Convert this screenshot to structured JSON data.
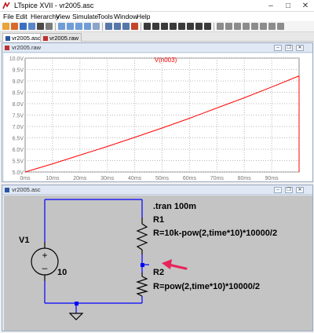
{
  "app": {
    "title": "LTspice XVII - vr2005.asc"
  },
  "menu": {
    "items": [
      "File",
      "Edit",
      "Hierarchy",
      "View",
      "Simulate",
      "Tools",
      "Window",
      "Help"
    ]
  },
  "tabs": [
    {
      "label": "vr2005.asc",
      "icon": "schematic-icon"
    },
    {
      "label": "vr2005.raw",
      "icon": "waveform-icon"
    }
  ],
  "waveform": {
    "window_title": "vr2005.raw",
    "trace_name": "V(n003)",
    "trace_color": "#ff0000",
    "y_ticks": [
      "10.0V",
      "9.5V",
      "9.0V",
      "8.5V",
      "8.0V",
      "7.5V",
      "7.0V",
      "6.5V",
      "6.0V",
      "5.5V",
      "5.0V"
    ],
    "x_ticks": [
      "0ms",
      "10ms",
      "20ms",
      "30ms",
      "40ms",
      "50ms",
      "60ms",
      "70ms",
      "80ms",
      "90ms"
    ]
  },
  "chart_data": {
    "type": "line",
    "title": "V(n003)",
    "xlabel": "",
    "ylabel": "",
    "xlim": [
      0,
      100
    ],
    "ylim": [
      5.0,
      10.0
    ],
    "x_unit": "ms",
    "y_unit": "V",
    "grid": true,
    "series": [
      {
        "name": "V(n003)",
        "color": "#ff0000",
        "x": [
          0,
          10,
          20,
          30,
          40,
          50,
          60,
          70,
          80,
          90,
          100
        ],
        "y": [
          5.0,
          5.36,
          5.74,
          6.12,
          6.52,
          6.93,
          7.36,
          7.81,
          8.26,
          8.73,
          9.22
        ]
      }
    ]
  },
  "schematic": {
    "window_title": "vr2005.asc",
    "directive": ".tran 100m",
    "r1_name": "R1",
    "r1_value": "R=10k-pow(2,time*10)*10000/2",
    "r2_name": "R2",
    "r2_value": "R=pow(2,time*10)*10000/2",
    "v1_name": "V1",
    "v1_value": "10",
    "arrow_color": "#e8225a"
  }
}
